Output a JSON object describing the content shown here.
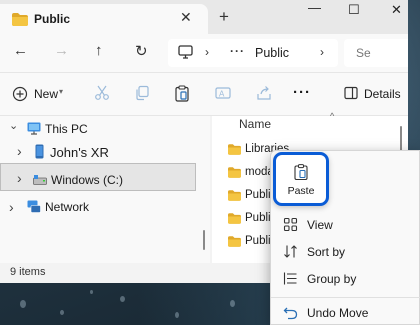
{
  "window": {
    "tab_title": "Public",
    "close_tab_symbol": "✕",
    "new_tab_symbol": "+",
    "minimize_symbol": "—",
    "maximize_symbol": "☐",
    "close_symbol": "✕"
  },
  "address_bar": {
    "back_icon": "←",
    "forward_icon": "→",
    "up_icon": "↑",
    "refresh_icon": "↻",
    "separator": "›",
    "overflow": "···",
    "crumb": "Public",
    "search_placeholder": "Se"
  },
  "command_bar": {
    "new_label": "New",
    "new_chevron": "▾",
    "more_symbol": "···",
    "details_label": "Details"
  },
  "nav_pane": {
    "items": [
      {
        "label": "This PC",
        "chevron": "⌄"
      },
      {
        "label": "John's XR",
        "chevron": "›"
      },
      {
        "label": "Windows (C:)",
        "chevron": "›"
      },
      {
        "label": "Network",
        "chevron": "›"
      }
    ]
  },
  "file_pane": {
    "column_header": "Name",
    "sort_chevron": "^",
    "files": [
      "Libraries",
      "moda",
      "Public",
      "Public",
      "Public"
    ]
  },
  "status_bar": {
    "item_count": "9 items"
  },
  "context_menu": {
    "paste_label": "Paste",
    "items": [
      {
        "label": "View",
        "icon": "grid-icon"
      },
      {
        "label": "Sort by",
        "icon": "sort-icon"
      },
      {
        "label": "Group by",
        "icon": "group-icon"
      },
      {
        "label": "Undo Move",
        "icon": "undo-icon"
      }
    ]
  },
  "colors": {
    "accent": "#0a5cd6",
    "folder": "#f4c542",
    "folder_dark": "#e0a92a"
  }
}
